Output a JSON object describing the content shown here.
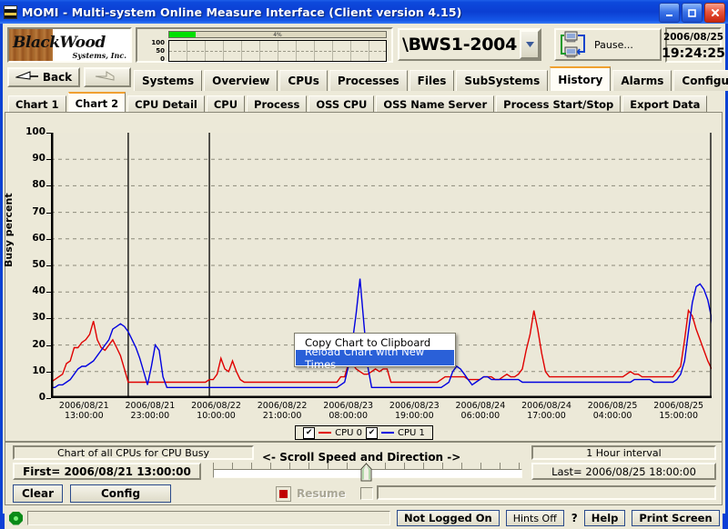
{
  "window": {
    "title": "MOMI - Multi-system Online Measure Interface (Client version 4.15)",
    "minimize_label": "_",
    "maximize_label": "□",
    "close_label": "✕"
  },
  "header": {
    "logo_text": "BlackWood",
    "logo_sub": "Systems, Inc.",
    "meter": {
      "label": "4%",
      "fill_percent": 12,
      "axis": [
        "100",
        "50",
        "0"
      ]
    },
    "system_name": "\\BWS1-2004",
    "system_dropdown_icon": "chevron-down-icon",
    "pause_label": "Pause...",
    "pause_icon": "two-computers-refresh-icon",
    "date": "2006/08/25",
    "time": "19:24:25"
  },
  "nav": {
    "back_label": "Back",
    "back_icon": "back-arrow-icon",
    "forward_icon": "forward-arrow-icon",
    "tabs": [
      {
        "label": "Systems",
        "active": false
      },
      {
        "label": "Overview",
        "active": false
      },
      {
        "label": "CPUs",
        "active": false
      },
      {
        "label": "Processes",
        "active": false
      },
      {
        "label": "Files",
        "active": false
      },
      {
        "label": "SubSystems",
        "active": false
      },
      {
        "label": "History",
        "active": true
      },
      {
        "label": "Alarms",
        "active": false
      },
      {
        "label": "Configure",
        "active": false
      }
    ]
  },
  "subtabs": [
    {
      "label": "Chart 1",
      "active": false
    },
    {
      "label": "Chart 2",
      "active": true
    },
    {
      "label": "CPU Detail",
      "active": false
    },
    {
      "label": "CPU",
      "active": false
    },
    {
      "label": "Process",
      "active": false
    },
    {
      "label": "OSS CPU",
      "active": false
    },
    {
      "label": "OSS Name Server",
      "active": false
    },
    {
      "label": "Process Start/Stop",
      "active": false
    },
    {
      "label": "Export Data",
      "active": false
    }
  ],
  "context_menu": {
    "items": [
      {
        "label": "Copy Chart to Clipboard",
        "selected": false
      },
      {
        "label": "Reload Chart with New Times",
        "selected": true
      }
    ]
  },
  "legend": [
    {
      "label": "CPU 0",
      "color": "#e00000",
      "checked": true,
      "check_glyph": "✔"
    },
    {
      "label": "CPU 1",
      "color": "#0000e0",
      "checked": true,
      "check_glyph": "✔"
    }
  ],
  "controls": {
    "chart_description": "Chart of all CPUs for CPU Busy",
    "first_label": "First= 2006/08/21 13:00:00",
    "last_label": "Last= 2006/08/25 18:00:00",
    "interval_label": "1 Hour interval",
    "scroll_label": "<-  Scroll Speed  and Direction  ->",
    "clear_label": "Clear",
    "config_label": "Config",
    "resume_label": "Resume",
    "resume_field_value": ""
  },
  "statusbar": {
    "status_icon": "green-status-octagon",
    "message": "",
    "not_logged_on": "Not Logged On",
    "hints": "Hints Off",
    "question": "?",
    "help": "Help",
    "print_screen": "Print Screen"
  },
  "chart_data": {
    "type": "line",
    "title": "Chart of all CPUs for CPU Busy",
    "xlabel": "",
    "ylabel": "Busy percent",
    "ylim": [
      0,
      100
    ],
    "ytick_values": [
      0,
      10,
      20,
      30,
      40,
      50,
      60,
      70,
      80,
      90,
      100
    ],
    "grid": true,
    "legend_position": "bottom-center",
    "x_start": "2006/08/21 13:00:00",
    "x_end": "2006/08/25 18:00:00",
    "interval": "1 Hour",
    "xtick_labels": [
      "2006/08/21\n13:00:00",
      "2006/08/21\n23:00:00",
      "2006/08/22\n10:00:00",
      "2006/08/22\n21:00:00",
      "2006/08/23\n08:00:00",
      "2006/08/23\n19:00:00",
      "2006/08/24\n06:00:00",
      "2006/08/24\n17:00:00",
      "2006/08/25\n04:00:00",
      "2006/08/25\n15:00:00"
    ],
    "marker_lines_x_index": [
      20,
      41
    ],
    "series": [
      {
        "name": "CPU 0",
        "color": "#e00000",
        "values": [
          6,
          7,
          8,
          9,
          13,
          14,
          19,
          19,
          21,
          22,
          24,
          29,
          22,
          19,
          18,
          20,
          22,
          19,
          16,
          11,
          6,
          6,
          6,
          6,
          6,
          6,
          6,
          6,
          6,
          6,
          6,
          6,
          6,
          6,
          6,
          6,
          6,
          6,
          6,
          6,
          6,
          7,
          7,
          9,
          15,
          11,
          10,
          14,
          10,
          7,
          6,
          6,
          6,
          6,
          6,
          6,
          6,
          6,
          6,
          6,
          6,
          6,
          6,
          6,
          6,
          6,
          6,
          6,
          6,
          6,
          6,
          6,
          6,
          6,
          6,
          8,
          8,
          13,
          13,
          11,
          10,
          9,
          9,
          10,
          11,
          10,
          11,
          11,
          6,
          6,
          6,
          6,
          6,
          6,
          6,
          6,
          6,
          6,
          6,
          6,
          6,
          7,
          8,
          8,
          8,
          8,
          8,
          8,
          7,
          7,
          7,
          7,
          8,
          8,
          8,
          7,
          7,
          8,
          9,
          8,
          8,
          9,
          11,
          18,
          24,
          33,
          26,
          17,
          10,
          8,
          8,
          8,
          8,
          8,
          8,
          8,
          8,
          8,
          8,
          8,
          8,
          8,
          8,
          8,
          8,
          8,
          8,
          8,
          8,
          9,
          10,
          9,
          9,
          8,
          8,
          8,
          8,
          8,
          8,
          8,
          8,
          8,
          10,
          12,
          22,
          33,
          31,
          26,
          22,
          18,
          14,
          11
        ]
      },
      {
        "name": "CPU 1",
        "color": "#0000e0",
        "values": [
          4,
          4,
          5,
          5,
          6,
          7,
          9,
          11,
          12,
          12,
          13,
          14,
          16,
          18,
          20,
          22,
          26,
          27,
          28,
          27,
          25,
          22,
          19,
          15,
          10,
          5,
          12,
          20,
          18,
          8,
          4,
          4,
          4,
          4,
          4,
          4,
          4,
          4,
          4,
          4,
          4,
          4,
          4,
          4,
          4,
          4,
          4,
          4,
          4,
          4,
          4,
          4,
          4,
          4,
          4,
          4,
          4,
          4,
          4,
          4,
          4,
          4,
          4,
          4,
          4,
          4,
          4,
          4,
          4,
          4,
          4,
          4,
          4,
          4,
          4,
          5,
          6,
          12,
          21,
          32,
          45,
          28,
          12,
          4,
          4,
          4,
          4,
          4,
          4,
          4,
          4,
          4,
          4,
          4,
          4,
          4,
          4,
          4,
          4,
          4,
          4,
          4,
          5,
          6,
          10,
          12,
          11,
          9,
          7,
          5,
          6,
          7,
          8,
          8,
          7,
          7,
          7,
          7,
          7,
          7,
          7,
          7,
          6,
          6,
          6,
          6,
          6,
          6,
          6,
          6,
          6,
          6,
          6,
          6,
          6,
          6,
          6,
          6,
          6,
          6,
          6,
          6,
          6,
          6,
          6,
          6,
          6,
          6,
          6,
          6,
          6,
          7,
          7,
          7,
          7,
          7,
          6,
          6,
          6,
          6,
          6,
          6,
          7,
          9,
          14,
          25,
          36,
          42,
          43,
          41,
          37,
          30,
          18
        ]
      }
    ]
  }
}
